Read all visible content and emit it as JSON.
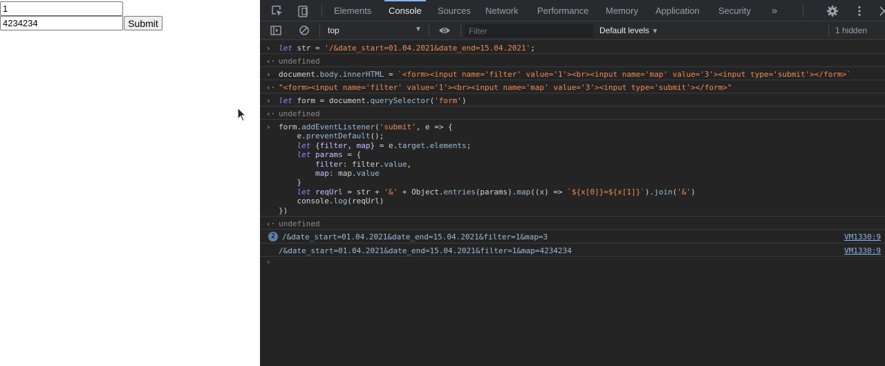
{
  "page": {
    "filter_value": "1",
    "map_value": "4234234",
    "submit_label": "Submit"
  },
  "devtools": {
    "tabs": [
      "Elements",
      "Console",
      "Sources",
      "Network",
      "Performance",
      "Memory",
      "Application",
      "Security"
    ],
    "active_tab": "Console",
    "more_tabs_glyph": "»",
    "toolbar": {
      "context": "top",
      "filter_placeholder": "Filter",
      "levels": "Default levels",
      "hidden": "1 hidden"
    },
    "console": {
      "line1": {
        "kw": "let",
        "rest": " str = ",
        "str": "'/&date_start=01.04.2021&date_end=15.04.2021'",
        "end": ";"
      },
      "result1": "undefined",
      "line2": {
        "a": "document.",
        "b": "body",
        "c": ".",
        "d": "innerHTML",
        "e": " = ",
        "str": "`<form><input name='filter' value='1'><br><input name='map' value='3'><input type='submit'></form>`"
      },
      "result2": "\"<form><input name='filter' value='1'><br><input name='map' value='3'><input type='submit'></form>\"",
      "line3": {
        "kw": "let",
        "mid": " form = document.",
        "fn": "querySelector",
        "open": "(",
        "str": "'form'",
        "close": ")"
      },
      "result3": "undefined",
      "block": {
        "l1a": "form.",
        "l1b": "addEventListener",
        "l1c": "(",
        "l1d": "'submit'",
        "l1e": ", e => {",
        "l2a": "    e.",
        "l2b": "preventDefault",
        "l2c": "();",
        "l3a": "    ",
        "l3k": "let",
        "l3b": " {",
        "l3c": "filter",
        "l3d": ", ",
        "l3e": "map",
        "l3f": "} = e.",
        "l3g": "target",
        "l3h": ".",
        "l3i": "elements",
        "l3j": ";",
        "l4a": "    ",
        "l4k": "let",
        "l4b": " params",
        "l4c": " = {",
        "l5a": "        ",
        "l5b": "filter",
        "l5c": ": filter.",
        "l5d": "value",
        "l5e": ",",
        "l6a": "        ",
        "l6b": "map",
        "l6c": ": map.",
        "l6d": "value",
        "l7": "    }",
        "l8a": "    ",
        "l8k": "let",
        "l8b": " reqUrl",
        "l8c": " = str + ",
        "l8d": "'&'",
        "l8e": " + Object.",
        "l8f": "entries",
        "l8g": "(params).",
        "l8h": "map",
        "l8i": "((",
        "l8j": "x",
        "l8l": ") => ",
        "l8m": "`${x[0]}=${x[1]}`",
        "l8n": ").",
        "l8o": "join",
        "l8p": "(",
        "l8q": "'&'",
        "l8r": ")",
        "l9a": "    console.",
        "l9b": "log",
        "l9c": "(reqUrl)",
        "l10": "})"
      },
      "result4": "undefined",
      "log1": {
        "count": "2",
        "text": "/&date_start=01.04.2021&date_end=15.04.2021&filter=1&map=3",
        "source": "VM1330:9"
      },
      "log2": {
        "text": "/&date_start=01.04.2021&date_end=15.04.2021&filter=1&map=4234234",
        "source": "VM1330:9"
      }
    }
  }
}
